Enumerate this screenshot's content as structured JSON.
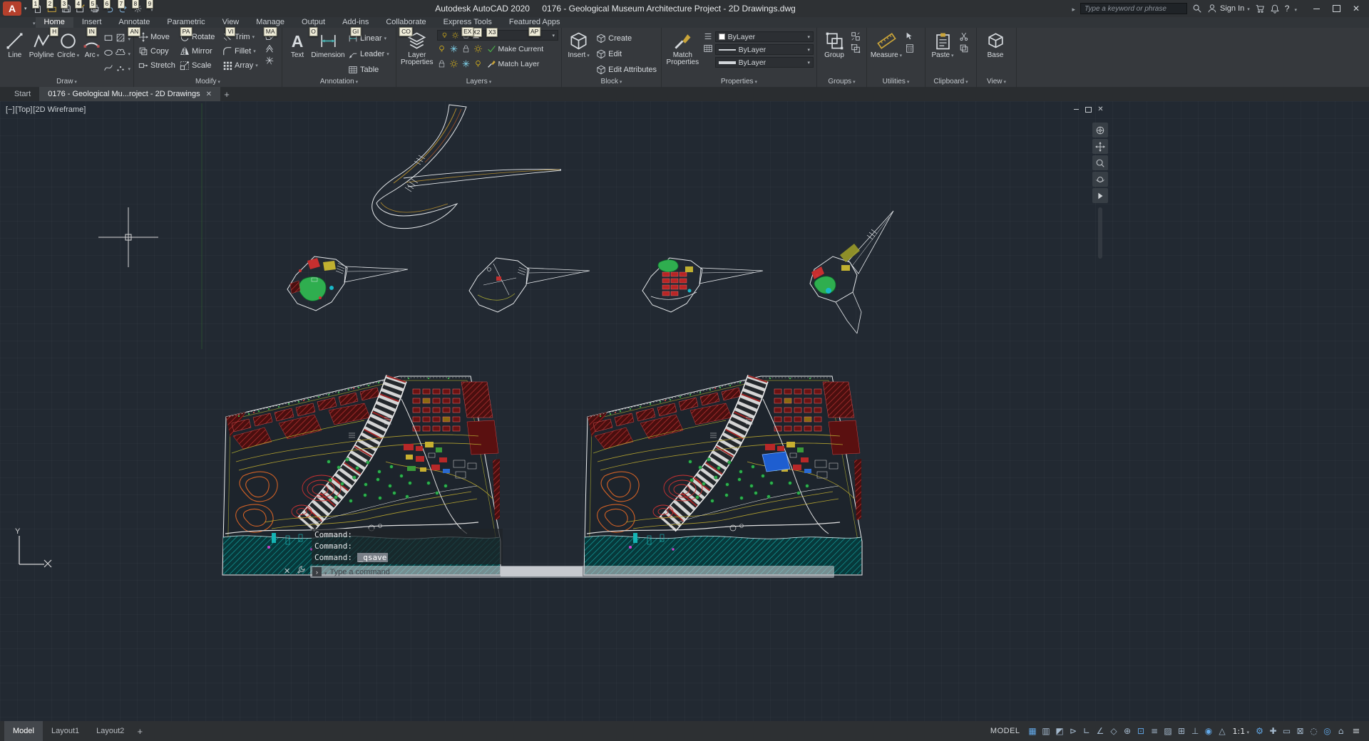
{
  "title_bar": {
    "app_title": "Autodesk AutoCAD 2020",
    "doc_title": "0176 - Geological Museum Architecture Project - 2D Drawings.dwg",
    "search_placeholder": "Type a keyword or phrase",
    "sign_in_label": "Sign In",
    "help_label": "?",
    "qat_keytips": [
      "1",
      "2",
      "3",
      "4",
      "5",
      "6",
      "7",
      "8",
      "9"
    ]
  },
  "ribbon": {
    "tabs": [
      {
        "name": "tab-home",
        "label": "Home",
        "keytip": "H",
        "active": true
      },
      {
        "name": "tab-insert",
        "label": "Insert",
        "keytip": "IN",
        "active": false
      },
      {
        "name": "tab-annotate",
        "label": "Annotate",
        "keytip": "AN",
        "active": false
      },
      {
        "name": "tab-parametric",
        "label": "Parametric",
        "keytip": "PA",
        "active": false
      },
      {
        "name": "tab-view",
        "label": "View",
        "keytip": "VI",
        "active": false
      },
      {
        "name": "tab-manage",
        "label": "Manage",
        "keytip": "MA",
        "active": false
      },
      {
        "name": "tab-output",
        "label": "Output",
        "keytip": "O",
        "active": false
      },
      {
        "name": "tab-add-ins",
        "label": "Add-ins",
        "keytip": "GI",
        "active": false
      },
      {
        "name": "tab-collaborate",
        "label": "Collaborate",
        "keytip": "CO",
        "active": false
      },
      {
        "name": "tab-express-tools",
        "label": "Express Tools",
        "keytip": "EX",
        "active": false
      },
      {
        "name": "tab-featured-apps",
        "label": "Featured Apps",
        "keytip": "AP",
        "active": false
      }
    ],
    "overflow_keytips": [
      "X2",
      "X3"
    ],
    "draw": {
      "label": "Draw",
      "line": "Line",
      "polyline": "Polyline",
      "circle": "Circle",
      "arc": "Arc"
    },
    "modify": {
      "label": "Modify",
      "move": "Move",
      "copy": "Copy",
      "stretch": "Stretch",
      "rotate": "Rotate",
      "mirror": "Mirror",
      "scale": "Scale",
      "trim": "Trim",
      "fillet": "Fillet",
      "array": "Array"
    },
    "annotation": {
      "label": "Annotation",
      "text": "Text",
      "dimension": "Dimension",
      "linear": "Linear",
      "leader": "Leader",
      "table": "Table"
    },
    "layers": {
      "label": "Layers",
      "layer_properties": "Layer Properties",
      "make_current": "Make Current",
      "match_layer": "Match Layer"
    },
    "block": {
      "label": "Block",
      "insert": "Insert",
      "create": "Create",
      "edit": "Edit",
      "edit_attributes": "Edit Attributes"
    },
    "properties": {
      "label": "Properties",
      "match_properties": "Match Properties",
      "color": "ByLayer",
      "linetype": "ByLayer",
      "lineweight": "ByLayer"
    },
    "groups": {
      "label": "Groups",
      "group": "Group"
    },
    "utilities": {
      "label": "Utilities",
      "measure": "Measure"
    },
    "clipboard": {
      "label": "Clipboard",
      "paste": "Paste"
    },
    "view": {
      "label": "View",
      "base": "Base"
    }
  },
  "file_tabs": {
    "start": "Start",
    "document": "0176 - Geological Mu...roject - 2D Drawings"
  },
  "viewport_controls": {
    "minimize": "[−]",
    "view": "[Top]",
    "visual_style": "[2D Wireframe]"
  },
  "canvas": {
    "ucs_y_label": "Y"
  },
  "command_line": {
    "history": [
      "Command:",
      "Command:"
    ],
    "last_prefix": "Command:",
    "last_command": "_qsave",
    "placeholder": "Type a command"
  },
  "status_bar": {
    "layout_tabs": [
      {
        "name": "model-tab",
        "label": "Model",
        "active": true
      },
      {
        "name": "layout1-tab",
        "label": "Layout1",
        "active": false
      },
      {
        "name": "layout2-tab",
        "label": "Layout2",
        "active": false
      }
    ],
    "space_label": "MODEL",
    "icons": [
      {
        "name": "grid-icon",
        "glyph": "▦",
        "on": true
      },
      {
        "name": "snap-mode-icon",
        "glyph": "▥",
        "on": false
      },
      {
        "name": "infer-constraints-icon",
        "glyph": "◩",
        "on": false
      },
      {
        "name": "dynamic-input-icon",
        "glyph": "⊳",
        "on": false
      },
      {
        "name": "ortho-icon",
        "glyph": "∟",
        "on": false
      },
      {
        "name": "polar-tracking-icon",
        "glyph": "∠",
        "on": false
      },
      {
        "name": "isodraft-icon",
        "glyph": "◇",
        "on": false
      },
      {
        "name": "osnap-tracking-icon",
        "glyph": "⊕",
        "on": false
      },
      {
        "name": "osnap-icon",
        "glyph": "⊡",
        "on": true
      },
      {
        "name": "lineweight-icon",
        "glyph": "≡",
        "on": false
      },
      {
        "name": "transparency-icon",
        "glyph": "▨",
        "on": false
      },
      {
        "name": "selection-cycling-icon",
        "glyph": "⊞",
        "on": false
      },
      {
        "name": "dynamic-ucs-icon",
        "glyph": "⊥",
        "on": false
      },
      {
        "name": "annotation-visibility-icon",
        "glyph": "◉",
        "on": true
      },
      {
        "name": "autoscale-icon",
        "glyph": "△",
        "on": false
      },
      {
        "name": "annotation-scale",
        "glyph": "1:1",
        "on": true,
        "wide": true
      },
      {
        "name": "workspace-icon",
        "glyph": "⚙",
        "on": true
      },
      {
        "name": "annotation-monitor-icon",
        "glyph": "✚",
        "on": false
      },
      {
        "name": "quick-properties-icon",
        "glyph": "▭",
        "on": false
      },
      {
        "name": "lock-ui-icon",
        "glyph": "⊠",
        "on": false
      },
      {
        "name": "isolate-objects-icon",
        "glyph": "◌",
        "on": false
      },
      {
        "name": "graphics-performance-icon",
        "glyph": "◎",
        "on": true
      },
      {
        "name": "clean-screen-icon",
        "glyph": "⌂",
        "on": false
      }
    ],
    "customize_glyph": "≡"
  }
}
